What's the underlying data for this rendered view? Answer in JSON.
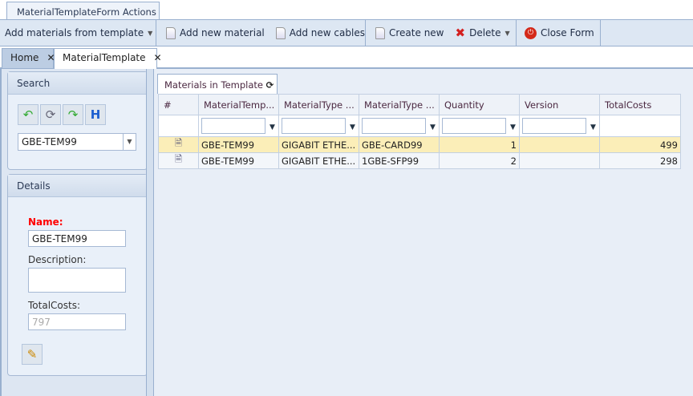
{
  "ribbon_tab": "MaterialTemplateForm Actions",
  "toolbar": {
    "add_from_template": "Add materials from template",
    "add_material": "Add new material",
    "add_cables": "Add new cables",
    "create_new": "Create new",
    "delete": "Delete",
    "close_form": "Close Form"
  },
  "doc_tabs": [
    {
      "label": "Home"
    },
    {
      "label": "MaterialTemplate"
    }
  ],
  "search": {
    "title": "Search",
    "selected": "GBE-TEM99"
  },
  "details": {
    "title": "Details",
    "name_label": "Name:",
    "name_value": "GBE-TEM99",
    "description_label": "Description:",
    "description_value": "",
    "totalcosts_label": "TotalCosts:",
    "totalcosts_value": "797"
  },
  "grid": {
    "tab_label": "Materials in Template",
    "columns": [
      "#",
      "MaterialTemp...",
      "MaterialType ...",
      "MaterialType ...",
      "Quantity",
      "Version",
      "TotalCosts"
    ],
    "rows": [
      [
        "GBE-TEM99",
        "GIGABIT ETHE...",
        "GBE-CARD99",
        "1",
        "",
        "499"
      ],
      [
        "GBE-TEM99",
        "GIGABIT ETHE...",
        "1GBE-SFP99",
        "2",
        "",
        "298"
      ]
    ]
  }
}
